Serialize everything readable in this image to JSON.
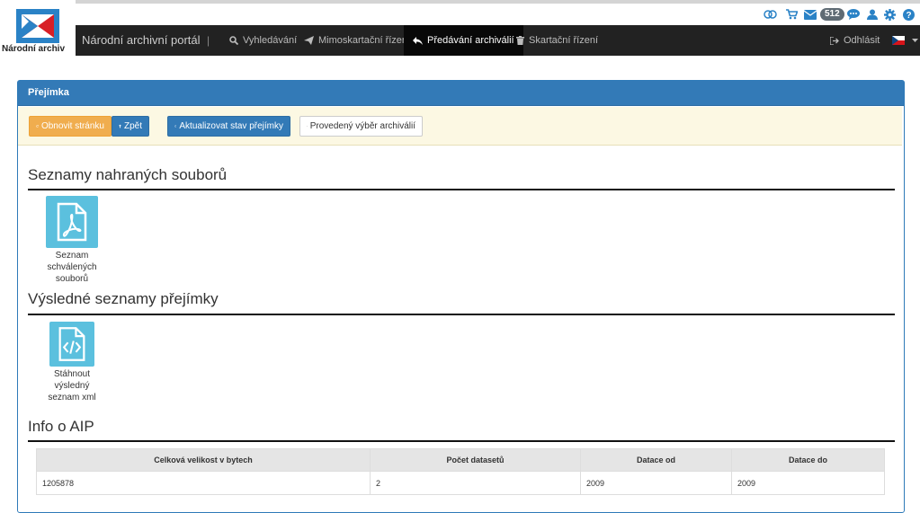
{
  "logo": {
    "text": "Národní archiv"
  },
  "iconbar": {
    "badge_count": "512"
  },
  "navbar": {
    "brand": "Národní archivní portál",
    "separator": "|",
    "items": [
      {
        "label": "Vyhledávání",
        "icon": "search-icon"
      },
      {
        "label": "Mimoskartační řízení",
        "icon": "paper-plane-icon"
      },
      {
        "label": "Předávání archiválií",
        "icon": "reply-icon",
        "active": true
      },
      {
        "label": "Skartační řízení",
        "icon": "trash-icon"
      }
    ],
    "logout": "Odhlásit",
    "language": "cs"
  },
  "panel": {
    "title": "Přejímka",
    "buttons": {
      "refresh": "Obnovit stránku",
      "back": "Zpět",
      "update_state": "Aktualizovat stav přejímky",
      "selection": "Provedený výběr archiválií"
    }
  },
  "sections": {
    "uploaded": {
      "title": "Seznamy nahraných souborů",
      "file_label_lines": [
        "Seznam",
        "schválených",
        "souborů"
      ]
    },
    "results": {
      "title": "Výsledné seznamy přejímky",
      "file_label_lines": [
        "Stáhnout",
        "výsledný",
        "seznam xml"
      ]
    },
    "info": {
      "title": "Info o AIP",
      "columns": [
        "Celková velikost v bytech",
        "Počet datasetů",
        "Datace od",
        "Datace do"
      ],
      "rows": [
        [
          "1205878",
          "2",
          "2009",
          "2009"
        ]
      ]
    }
  },
  "colors": {
    "navbar": "#222222",
    "panel_header": "#337ab7",
    "toolbar": "#fcf8e3",
    "file_icon": "#5bc0de",
    "warning": "#f0ad4e"
  }
}
